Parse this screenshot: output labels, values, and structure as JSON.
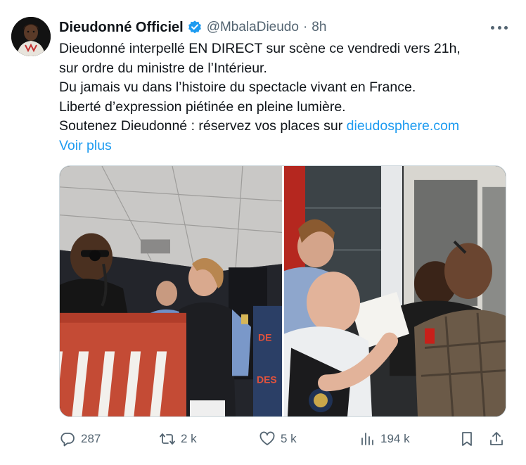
{
  "author": {
    "display_name": "Dieudonné Officiel",
    "handle": "@MbalaDieudo",
    "separator": "·",
    "time": "8h",
    "verified_color": "#1d9bf0"
  },
  "tweet": {
    "lines": [
      "Dieudonné interpellé EN DIRECT sur scène ce vendredi vers 21h,",
      "sur ordre du ministre de l’Intérieur.",
      "Du jamais vu dans l’histoire du spectacle vivant en France.",
      "Liberté d’expression piétinée en pleine lumière."
    ],
    "last_line_prefix": "Soutenez Dieudonné : réservez vos places sur ",
    "link_text": "dieudosphere.com",
    "show_more": "Voir plus",
    "link_color": "#1d9bf0"
  },
  "media": {
    "photos": [
      {
        "subject": "stage-arrest-photo"
      },
      {
        "subject": "backstage-gendarmes-photo"
      }
    ]
  },
  "actions": {
    "reply_count": "287",
    "retweet_count": "2 k",
    "like_count": "5 k",
    "views_count": "194 k",
    "icon_color": "#536471"
  }
}
